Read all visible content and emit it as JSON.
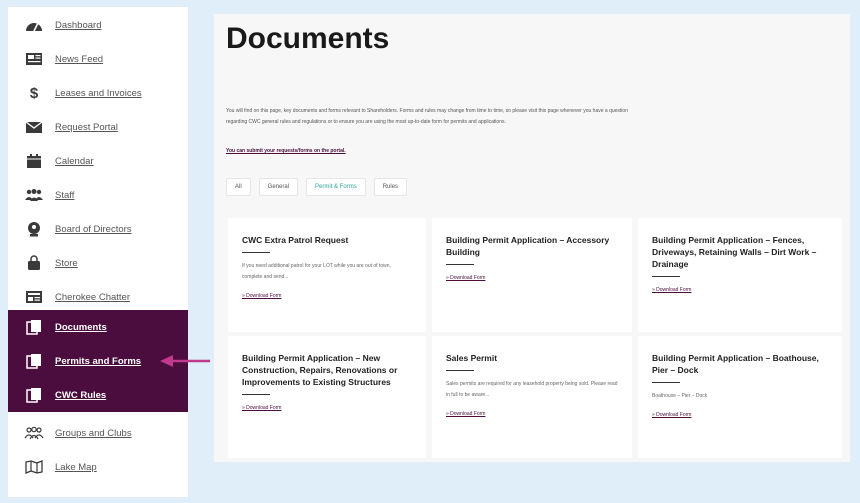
{
  "sidebar": {
    "items": [
      {
        "label": "Dashboard",
        "icon": "dashboard-icon"
      },
      {
        "label": "News Feed",
        "icon": "news-feed-icon"
      },
      {
        "label": "Leases and Invoices",
        "icon": "dollar-icon"
      },
      {
        "label": "Request Portal",
        "icon": "envelope-icon"
      },
      {
        "label": "Calendar",
        "icon": "calendar-icon"
      },
      {
        "label": "Staff",
        "icon": "people-icon"
      },
      {
        "label": "Board of Directors",
        "icon": "board-icon"
      },
      {
        "label": "Store",
        "icon": "bag-icon"
      },
      {
        "label": "Cherokee Chatter",
        "icon": "newspaper-icon"
      },
      {
        "label": "Documents",
        "icon": "documents-icon"
      },
      {
        "label": "Permits and Forms",
        "icon": "documents-icon"
      },
      {
        "label": "CWC Rules",
        "icon": "documents-icon"
      },
      {
        "label": "Groups and Clubs",
        "icon": "groups-icon"
      },
      {
        "label": "Lake Map",
        "icon": "map-icon"
      }
    ],
    "active_color": "#4a0d3d"
  },
  "main": {
    "title": "Documents",
    "intro": "You will find on this page, key documents and forms relevant to Shareholders. Forms and rules may change from time to time, so please visit this page whenever you have a question regarding CWC general rules and regulations or to ensure you are using the most up-to-date form for permits and applications.",
    "intro_link": "You can submit your requests/forms on the portal.",
    "filters": [
      "All",
      "General",
      "Permit & Forms",
      "Rules"
    ],
    "active_filter": "Permit & Forms",
    "cards": [
      {
        "title": "CWC Extra Patrol Request",
        "desc": "If you need additional patrol for your LOT while you are out of town, complete and send...",
        "link": "Download Form"
      },
      {
        "title": "Building Permit Application – Accessory Building",
        "desc": "",
        "link": "Download Form"
      },
      {
        "title": "Building Permit Application – Fences, Driveways, Retaining Walls – Dirt Work – Drainage",
        "desc": "",
        "link": "Download Form"
      },
      {
        "title": "Building Permit Application – New Construction, Repairs, Renovations or Improvements to Existing Structures",
        "desc": "",
        "link": "Download Form"
      },
      {
        "title": "Sales Permit",
        "desc": "Sales permits are required for any leasehold property being sold. Please read in full to be aware...",
        "link": "Download Form"
      },
      {
        "title": "Building Permit Application – Boathouse, Pier – Dock",
        "desc": "Boathouse – Pier – Dock",
        "link": "Download Form"
      }
    ]
  },
  "arrow_color": "#c0398a"
}
